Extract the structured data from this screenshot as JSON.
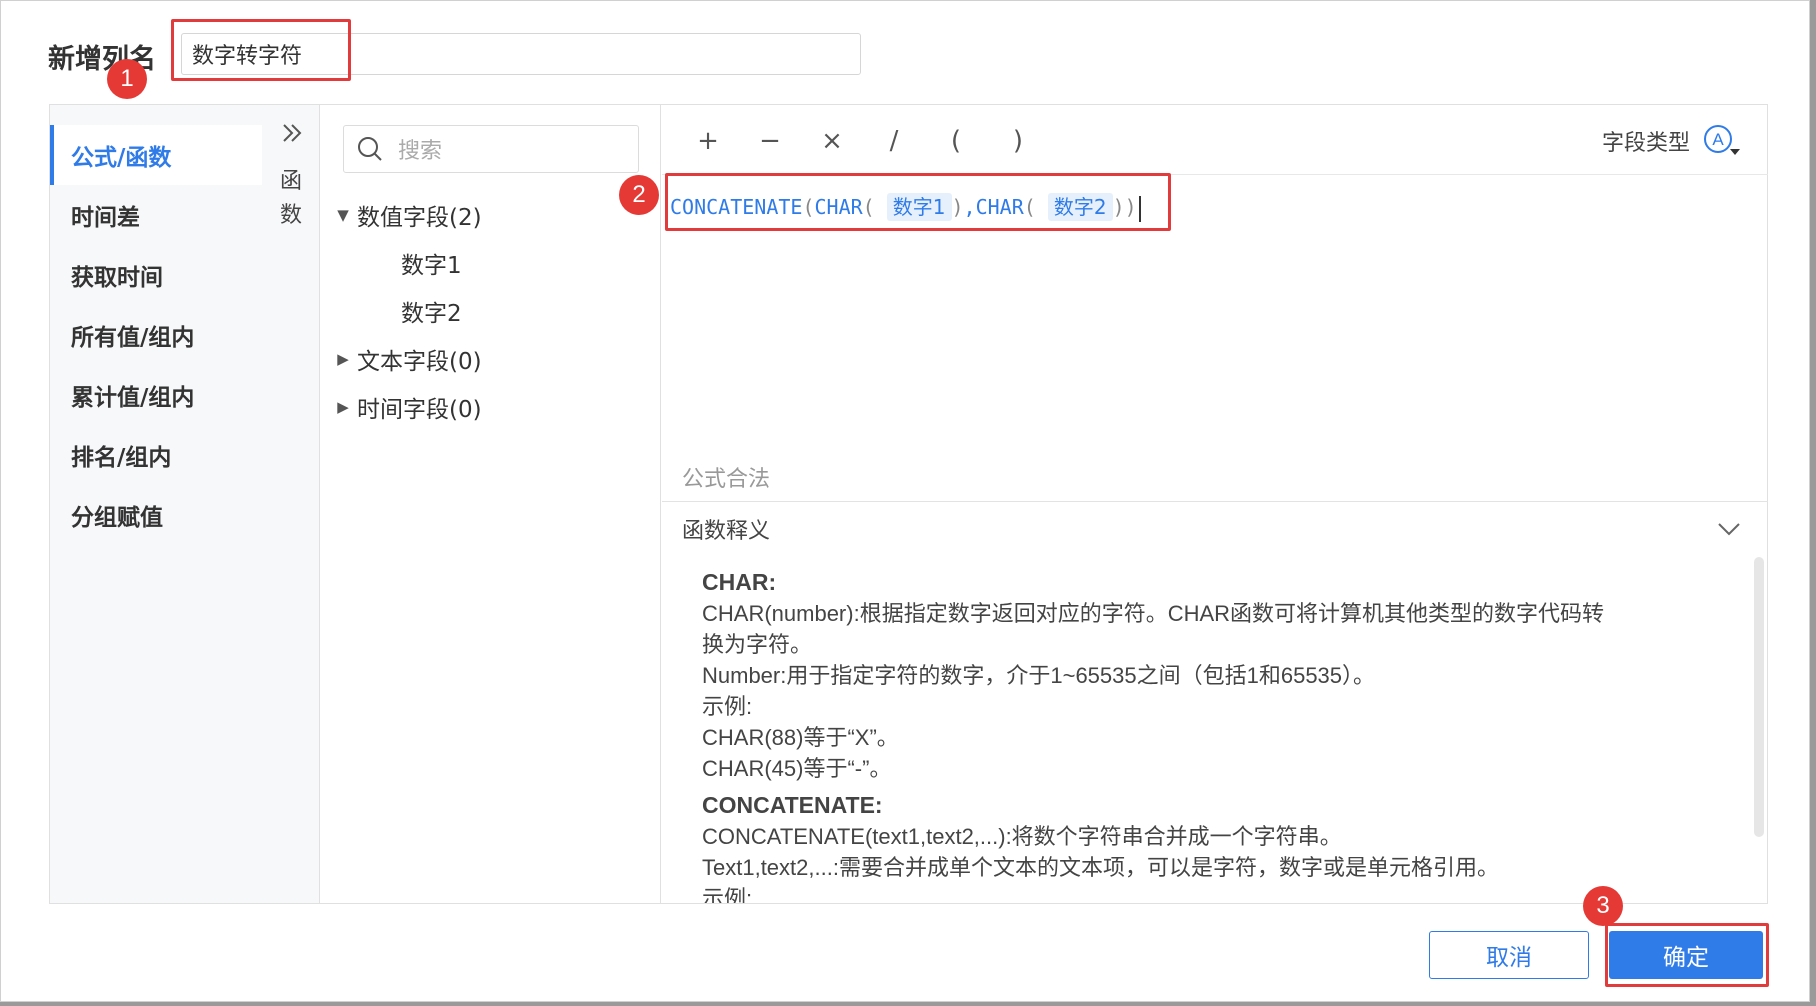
{
  "dialog": {
    "title": "新增列名",
    "name_value": "数字转字符"
  },
  "categories": [
    {
      "label": "公式/函数",
      "active": true
    },
    {
      "label": "时间差"
    },
    {
      "label": "获取时间"
    },
    {
      "label": "所有值/组内"
    },
    {
      "label": "累计值/组内"
    },
    {
      "label": "排名/组内"
    },
    {
      "label": "分组赋值"
    }
  ],
  "collapse_panel": {
    "text_1": "函",
    "text_2": "数"
  },
  "search": {
    "placeholder": "搜索"
  },
  "fields": {
    "numeric_group": "数值字段(2)",
    "numeric_items": [
      "数字1",
      "数字2"
    ],
    "text_group": "文本字段(0)",
    "time_group": "时间字段(0)"
  },
  "toolbar": {
    "operators": [
      "+",
      "−",
      "×",
      "/",
      "(",
      ")"
    ],
    "field_type_label": "字段类型"
  },
  "formula": {
    "fn_outer": "CONCATENATE",
    "fn_char": "CHAR",
    "field_1": "数字1",
    "field_2": "数字2",
    "open_paren": "(",
    "close_paren": ")",
    "comma": ","
  },
  "validation": {
    "text": "公式合法"
  },
  "doc": {
    "title": "函数释义",
    "char_name": "CHAR:",
    "char_line_1": "CHAR(number):根据指定数字返回对应的字符。CHAR函数可将计算机其他类型的数字代码转",
    "char_line_2": "换为字符。",
    "char_line_3": "Number:用于指定字符的数字，介于1~65535之间（包括1和65535）。",
    "char_line_4": "示例:",
    "char_line_5": "CHAR(88)等于“X”。",
    "char_line_6": "CHAR(45)等于“-”。",
    "concat_name": "CONCATENATE:",
    "concat_line_1": "CONCATENATE(text1,text2,...):将数个字符串合并成一个字符串。",
    "concat_line_2": "Text1,text2,...:需要合并成单个文本的文本项，可以是字符，数字或是单元格引用。",
    "concat_line_3": "示例:"
  },
  "annotations": [
    "1",
    "2",
    "3"
  ],
  "buttons": {
    "cancel": "取消",
    "ok": "确定"
  },
  "colors": {
    "accent": "#2f7be8",
    "highlight": "#e23b3b",
    "badge": "#e53935"
  }
}
